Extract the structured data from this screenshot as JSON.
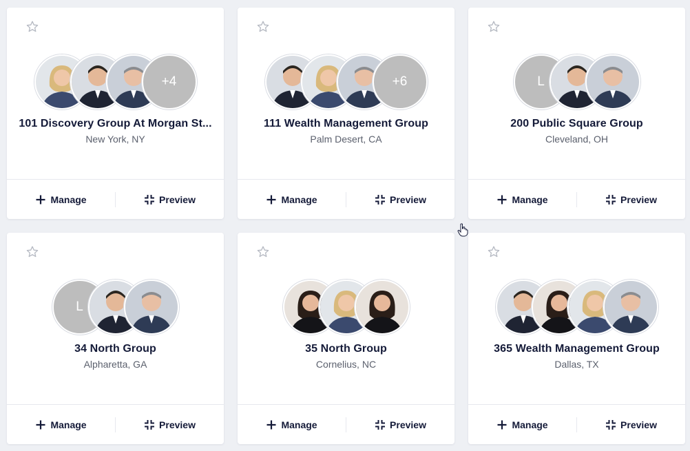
{
  "actions": {
    "manage_label": "Manage",
    "preview_label": "Preview"
  },
  "groups": [
    {
      "name": "101 Discovery Group At Morgan St...",
      "location": "New York, NY",
      "extra_count": "+4"
    },
    {
      "name": "111 Wealth Management Group",
      "location": "Palm Desert, CA",
      "extra_count": "+6"
    },
    {
      "name": "200 Public Square Group",
      "location": "Cleveland, OH",
      "initial": "L"
    },
    {
      "name": "34 North Group",
      "location": "Alpharetta, GA",
      "initial": "L"
    },
    {
      "name": "35 North Group",
      "location": "Cornelius, NC"
    },
    {
      "name": "365 Wealth Management Group",
      "location": "Dallas, TX"
    }
  ],
  "colors": {
    "text": "#141a38",
    "subtext": "#5b606d",
    "placeholder": "#bdbdbd",
    "background": "#eef0f4"
  }
}
